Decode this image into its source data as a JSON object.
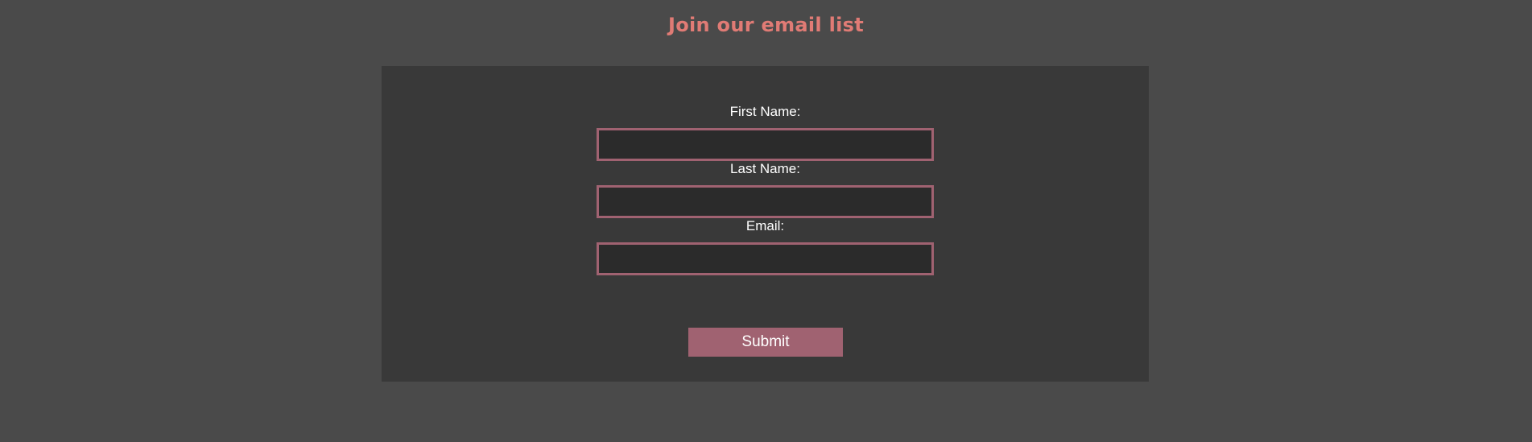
{
  "header": {
    "title": "Join our email list"
  },
  "form": {
    "first_name_label": "First Name:",
    "first_name_value": "",
    "last_name_label": "Last Name:",
    "last_name_value": "",
    "email_label": "Email:",
    "email_value": "",
    "submit_label": "Submit"
  },
  "colors": {
    "page_background": "#4a4a4a",
    "panel_background": "#393939",
    "input_background": "#2b2b2b",
    "accent": "#a06271",
    "title": "#e07b75"
  }
}
